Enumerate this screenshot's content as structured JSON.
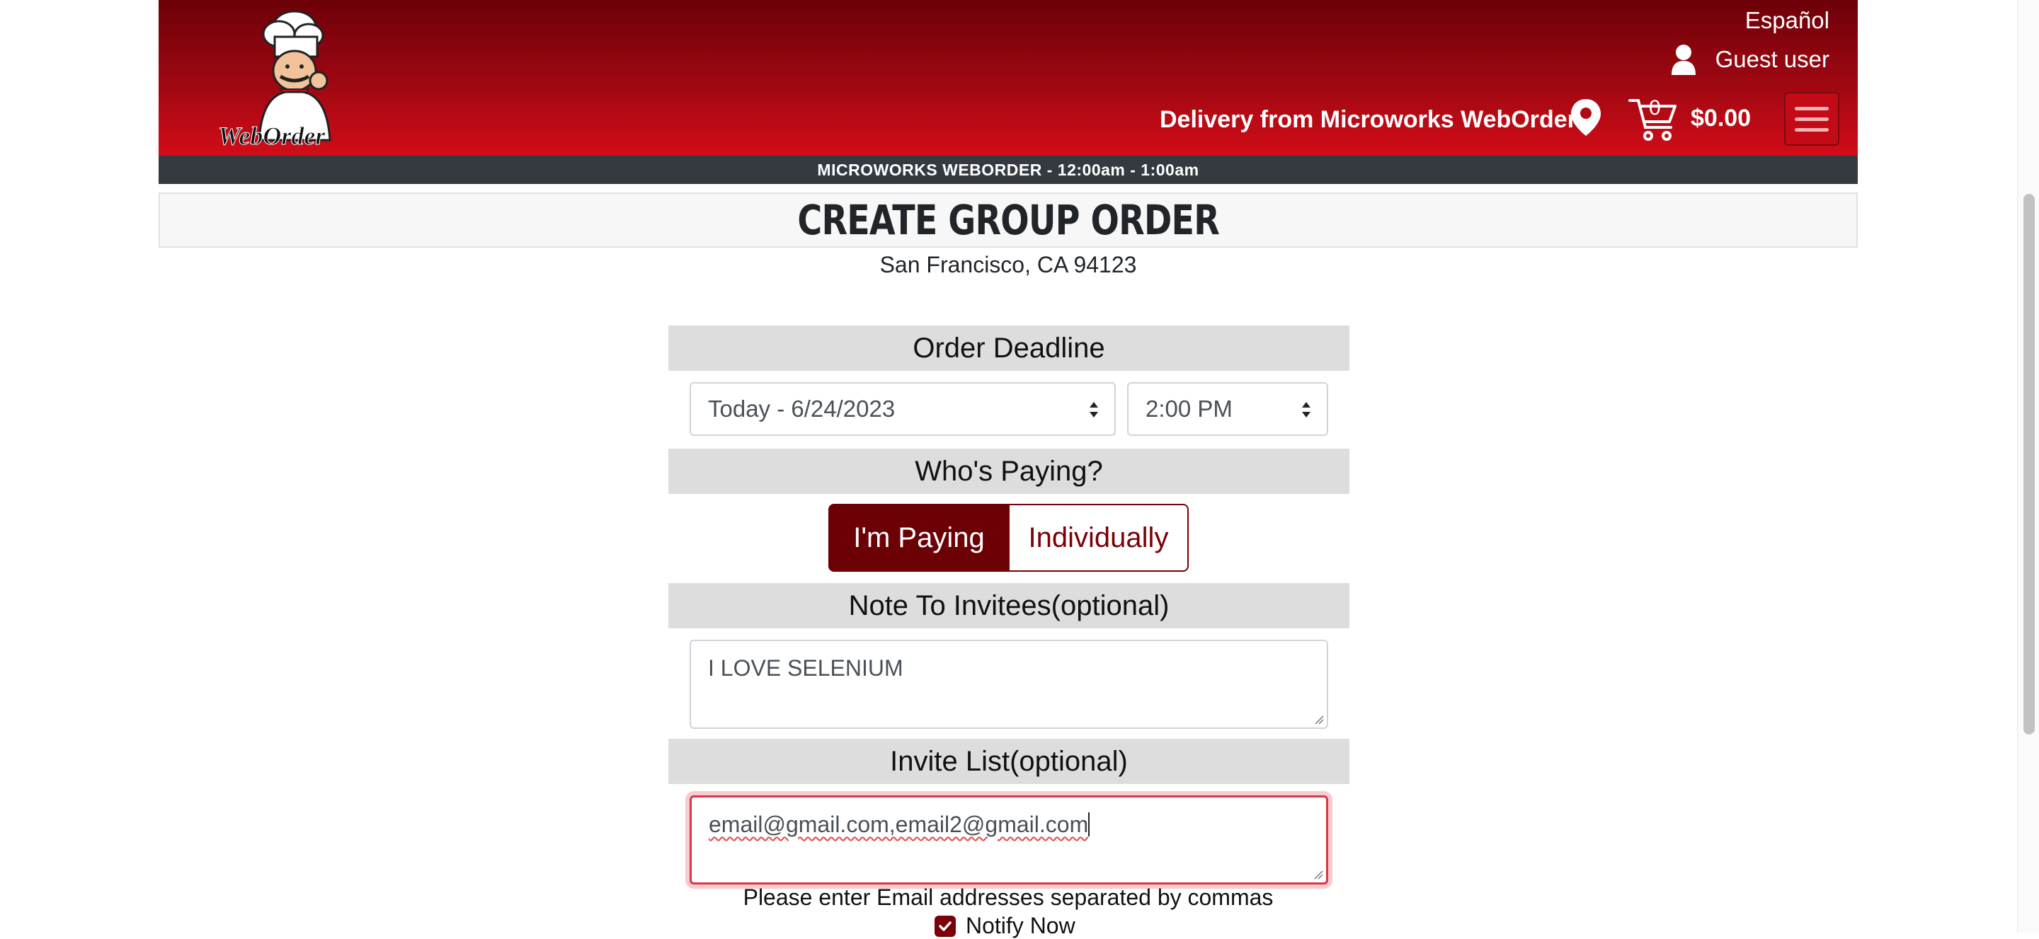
{
  "header": {
    "logo_text": "WebOrder",
    "language_link": "Español",
    "user_label": "Guest user",
    "delivery_text": "Delivery from Microworks WebOrder",
    "cart_count": "0",
    "cart_total": "$0.00"
  },
  "store_bar": "MICROWORKS WEBORDER - 12:00am - 1:00am",
  "page": {
    "title": "CREATE GROUP ORDER",
    "address": "San Francisco, CA 94123"
  },
  "deadline": {
    "heading": "Order Deadline",
    "date_selected": "Today - 6/24/2023",
    "time_selected": "2:00 PM"
  },
  "paying": {
    "heading": "Who's Paying?",
    "option_self": "I'm Paying",
    "option_individual": "Individually",
    "selected": "I'm Paying"
  },
  "note": {
    "heading": "Note To Invitees(optional)",
    "value": "I LOVE SELENIUM"
  },
  "invite": {
    "heading": "Invite List(optional)",
    "value": "email@gmail.com,email2@gmail.com",
    "hint": "Please enter Email addresses separated by commas",
    "notify_label": "Notify Now",
    "notify_checked": true
  },
  "colors": {
    "brand_red": "#c30b17",
    "dark_red": "#6b0005",
    "store_bar": "#343a40",
    "section_gray": "#dddddd",
    "error_red": "#dc3545"
  },
  "icons": [
    "chef-logo",
    "user-icon",
    "location-pin-icon",
    "cart-icon",
    "hamburger-menu-icon",
    "checkbox-check-icon"
  ]
}
